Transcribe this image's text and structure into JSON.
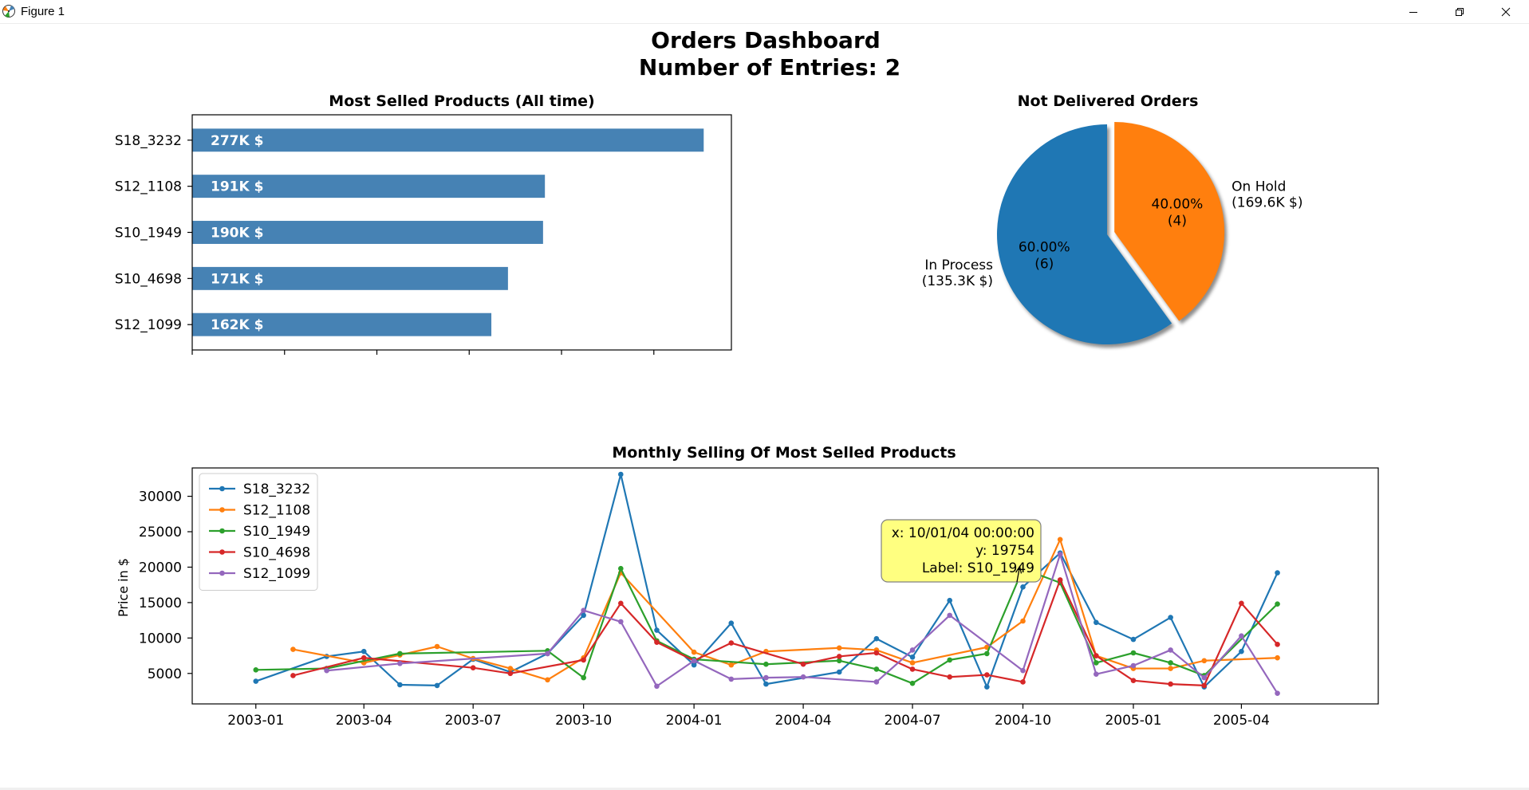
{
  "window": {
    "title": "Figure 1"
  },
  "figure": {
    "suptitle_line1": "Orders Dashboard",
    "suptitle_line2": "Number of Entries: 2"
  },
  "chart_data": [
    {
      "type": "bar",
      "orientation": "horizontal",
      "title": "Most Selled Products (All time)",
      "categories": [
        "S18_3232",
        "S12_1108",
        "S10_1949",
        "S10_4698",
        "S12_1099"
      ],
      "values": [
        277000,
        191000,
        190000,
        171000,
        162000
      ],
      "labels": [
        "277K $",
        "191K $",
        "190K $",
        "171K $",
        "162K $"
      ],
      "bar_color": "#4682b4",
      "xlim": [
        0,
        292000
      ],
      "x_tick_values": [
        0,
        50000,
        100000,
        150000,
        200000,
        250000
      ],
      "x_tick_labels_visible": false
    },
    {
      "type": "pie",
      "title": "Not Delivered Orders",
      "slices": [
        {
          "label": "In Process",
          "amount": "(135.3K $)",
          "percent": "60.00%",
          "count": "(6)",
          "value": 6,
          "color": "#1f77b4",
          "exploded": false
        },
        {
          "label": "On Hold",
          "amount": "(169.6K $)",
          "percent": "40.00%",
          "count": "(4)",
          "value": 4,
          "color": "#ff7f0e",
          "exploded": true
        }
      ],
      "startangle": 90,
      "shadow": true
    },
    {
      "type": "line",
      "title": "Monthly Selling Of Most Selled Products",
      "ylabel": "Price in $",
      "xlabel": "",
      "ylim": [
        700,
        34000
      ],
      "xlim": [
        "2002-11-09",
        "2005-07-24"
      ],
      "x_ticks": [
        "2003-01",
        "2003-04",
        "2003-07",
        "2003-10",
        "2004-01",
        "2004-04",
        "2004-07",
        "2004-10",
        "2005-01",
        "2005-04"
      ],
      "y_ticks": [
        5000,
        10000,
        15000,
        20000,
        25000,
        30000
      ],
      "legend_position": "upper-left",
      "series": [
        {
          "name": "S18_3232",
          "color": "#1f77b4",
          "points": [
            [
              "2003-01",
              3900
            ],
            [
              "2003-03",
              7400
            ],
            [
              "2003-04",
              8100
            ],
            [
              "2003-05",
              3400
            ],
            [
              "2003-06",
              3300
            ],
            [
              "2003-07",
              7000
            ],
            [
              "2003-08",
              5200
            ],
            [
              "2003-09",
              7800
            ],
            [
              "2003-10",
              13200
            ],
            [
              "2003-11",
              33100
            ],
            [
              "2003-12",
              11100
            ],
            [
              "2004-01",
              6200
            ],
            [
              "2004-02",
              12100
            ],
            [
              "2004-03",
              3500
            ],
            [
              "2004-05",
              5200
            ],
            [
              "2004-06",
              9900
            ],
            [
              "2004-07",
              7300
            ],
            [
              "2004-08",
              15300
            ],
            [
              "2004-09",
              3100
            ],
            [
              "2004-10",
              17200
            ],
            [
              "2004-11",
              22000
            ],
            [
              "2004-12",
              12200
            ],
            [
              "2005-01",
              9800
            ],
            [
              "2005-02",
              12900
            ],
            [
              "2005-03",
              3100
            ],
            [
              "2005-04",
              8100
            ],
            [
              "2005-05",
              19200
            ]
          ]
        },
        {
          "name": "S12_1108",
          "color": "#ff7f0e",
          "points": [
            [
              "2003-02",
              8400
            ],
            [
              "2003-04",
              6500
            ],
            [
              "2003-05",
              7600
            ],
            [
              "2003-06",
              8800
            ],
            [
              "2003-07",
              7100
            ],
            [
              "2003-08",
              5700
            ],
            [
              "2003-09",
              4100
            ],
            [
              "2003-10",
              7200
            ],
            [
              "2003-11",
              19200
            ],
            [
              "2004-01",
              8000
            ],
            [
              "2004-02",
              6200
            ],
            [
              "2004-03",
              8100
            ],
            [
              "2004-05",
              8600
            ],
            [
              "2004-06",
              8300
            ],
            [
              "2004-07",
              6500
            ],
            [
              "2004-09",
              8700
            ],
            [
              "2004-10",
              12400
            ],
            [
              "2004-11",
              23900
            ],
            [
              "2004-12",
              7500
            ],
            [
              "2005-01",
              5700
            ],
            [
              "2005-02",
              5700
            ],
            [
              "2005-03",
              6800
            ],
            [
              "2005-05",
              7200
            ]
          ]
        },
        {
          "name": "S10_1949",
          "color": "#2ca02c",
          "points": [
            [
              "2003-01",
              5500
            ],
            [
              "2003-03",
              5700
            ],
            [
              "2003-05",
              7800
            ],
            [
              "2003-09",
              8200
            ],
            [
              "2003-10",
              4400
            ],
            [
              "2003-11",
              19800
            ],
            [
              "2003-12",
              9600
            ],
            [
              "2004-01",
              7000
            ],
            [
              "2004-03",
              6300
            ],
            [
              "2004-05",
              6800
            ],
            [
              "2004-06",
              5600
            ],
            [
              "2004-07",
              3600
            ],
            [
              "2004-08",
              6900
            ],
            [
              "2004-09",
              7800
            ],
            [
              "2004-10",
              19754
            ],
            [
              "2004-11",
              17800
            ],
            [
              "2004-12",
              6500
            ],
            [
              "2005-01",
              7900
            ],
            [
              "2005-02",
              6500
            ],
            [
              "2005-03",
              4700
            ],
            [
              "2005-05",
              14800
            ]
          ]
        },
        {
          "name": "S10_4698",
          "color": "#d62728",
          "points": [
            [
              "2003-02",
              4700
            ],
            [
              "2003-04",
              7200
            ],
            [
              "2003-07",
              5800
            ],
            [
              "2003-08",
              5000
            ],
            [
              "2003-10",
              6900
            ],
            [
              "2003-11",
              14900
            ],
            [
              "2003-12",
              9400
            ],
            [
              "2004-01",
              6800
            ],
            [
              "2004-02",
              9300
            ],
            [
              "2004-04",
              6300
            ],
            [
              "2004-05",
              7400
            ],
            [
              "2004-06",
              7900
            ],
            [
              "2004-07",
              5600
            ],
            [
              "2004-08",
              4500
            ],
            [
              "2004-09",
              4800
            ],
            [
              "2004-10",
              3800
            ],
            [
              "2004-11",
              18200
            ],
            [
              "2004-12",
              7500
            ],
            [
              "2005-01",
              4000
            ],
            [
              "2005-02",
              3500
            ],
            [
              "2005-03",
              3300
            ],
            [
              "2005-04",
              14900
            ],
            [
              "2005-05",
              9100
            ]
          ]
        },
        {
          "name": "S12_1099",
          "color": "#9467bd",
          "points": [
            [
              "2003-03",
              5400
            ],
            [
              "2003-05",
              6400
            ],
            [
              "2003-09",
              7800
            ],
            [
              "2003-10",
              13900
            ],
            [
              "2003-11",
              12300
            ],
            [
              "2003-12",
              3200
            ],
            [
              "2004-01",
              6800
            ],
            [
              "2004-02",
              4200
            ],
            [
              "2004-03",
              4400
            ],
            [
              "2004-04",
              4500
            ],
            [
              "2004-06",
              3800
            ],
            [
              "2004-07",
              8300
            ],
            [
              "2004-08",
              13200
            ],
            [
              "2004-10",
              5400
            ],
            [
              "2004-11",
              21800
            ],
            [
              "2004-12",
              4900
            ],
            [
              "2005-01",
              6100
            ],
            [
              "2005-02",
              8300
            ],
            [
              "2005-03",
              4400
            ],
            [
              "2005-04",
              10300
            ],
            [
              "2005-05",
              2200
            ]
          ]
        }
      ],
      "annotation": {
        "line1": "x: 10/01/04 00:00:00",
        "line2": "y: 19754",
        "line3": "Label: S10_1949",
        "target_x": "2004-10",
        "target_y": 19754,
        "box_color": "#ffff80"
      }
    }
  ]
}
